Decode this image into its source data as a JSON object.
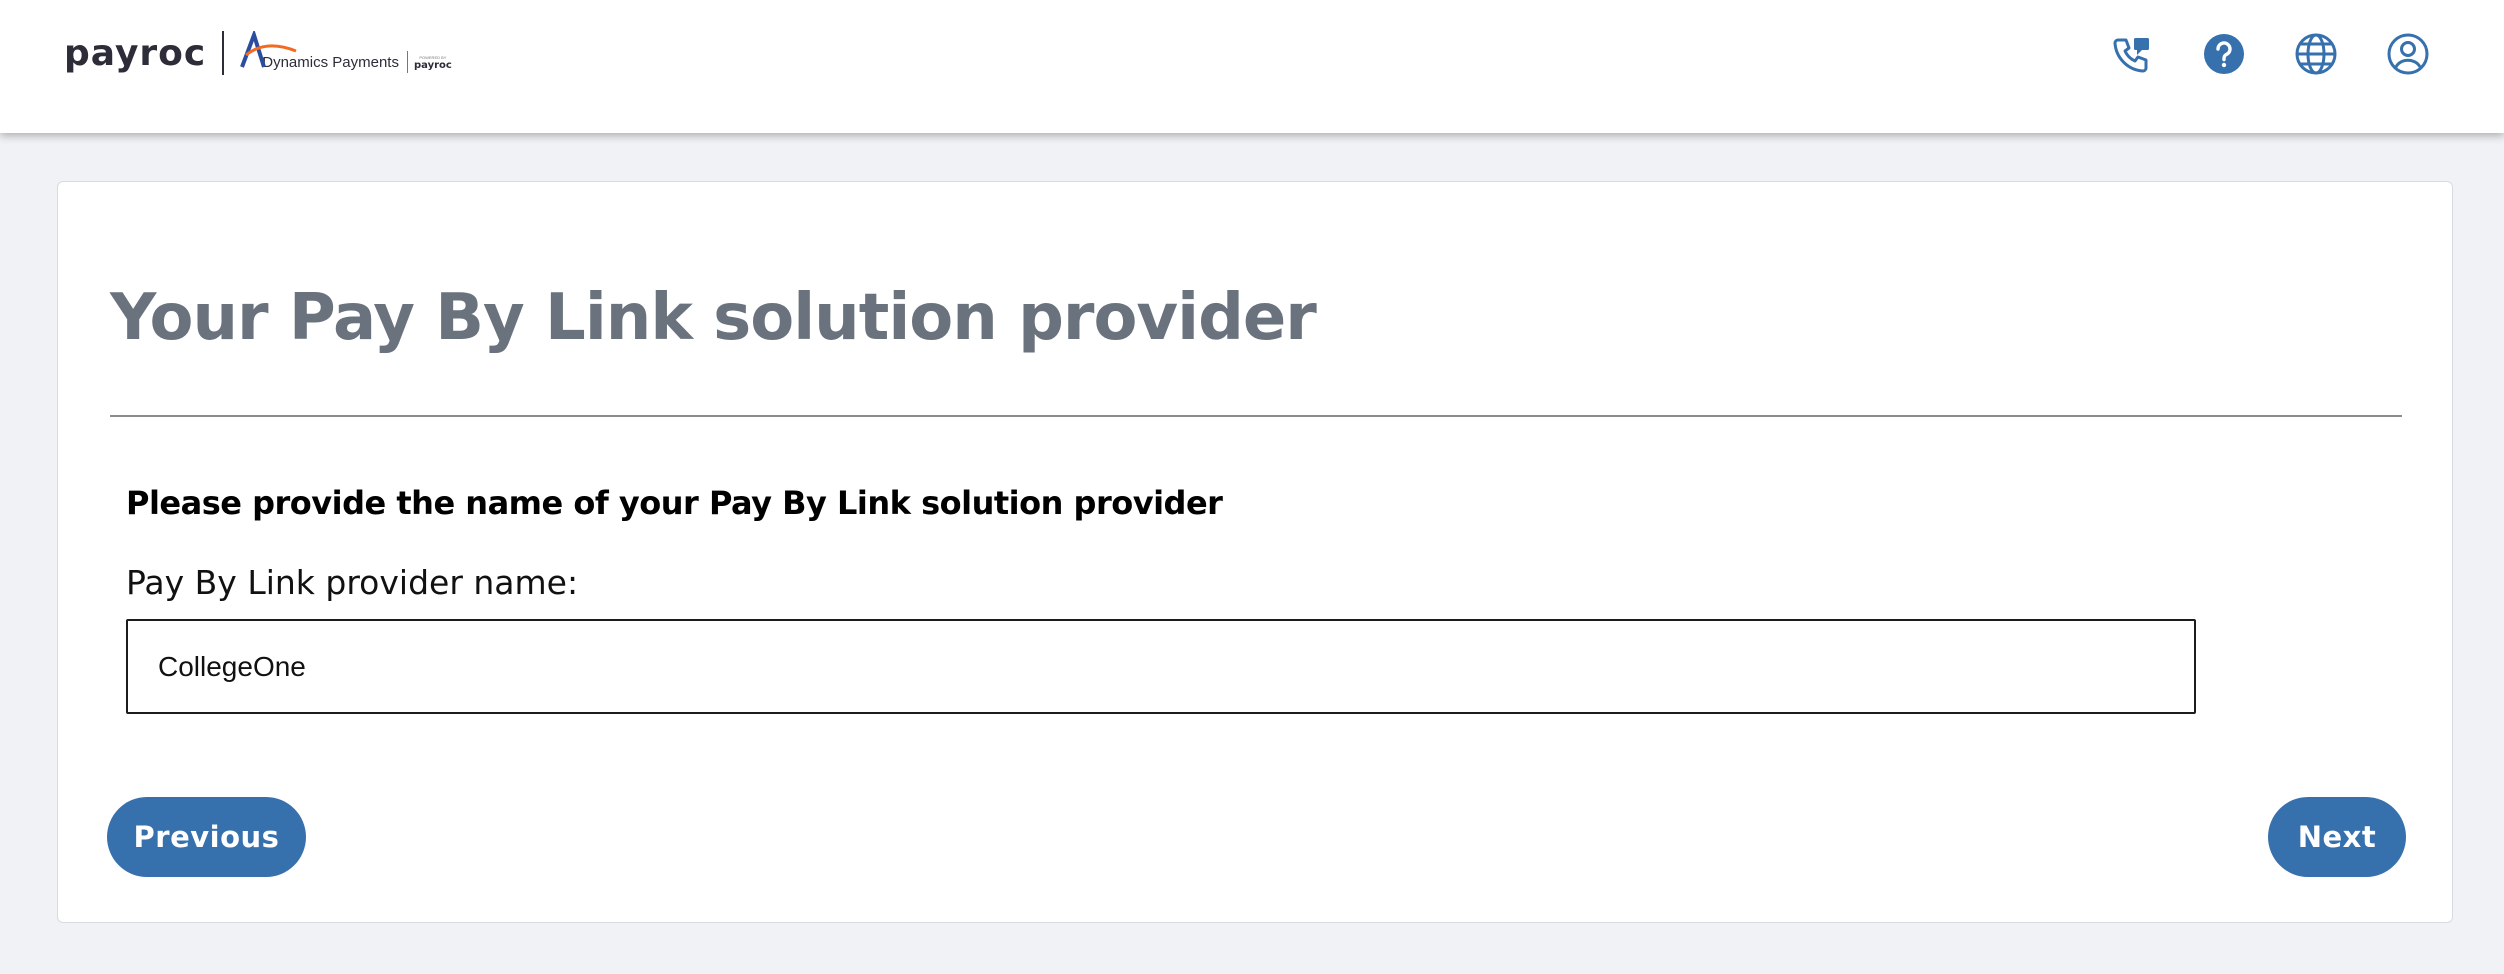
{
  "header": {
    "logo_text": "payroc",
    "logo_partner_text": "Dynamics Payments",
    "logo_partner_sub_top": "POWERED BY",
    "logo_partner_sub": "payroc",
    "icons": [
      "phone-chat-icon",
      "help-icon",
      "globe-icon",
      "account-icon"
    ]
  },
  "page": {
    "title": "Your Pay By Link solution provider",
    "question": "Please provide the name of your Pay By Link solution provider",
    "field": {
      "label": "Pay By Link provider name:",
      "value": "CollegeOne"
    },
    "buttons": {
      "previous": "Previous",
      "next": "Next"
    }
  },
  "colors": {
    "primary": "#3670ad",
    "title": "#6a737d",
    "background": "#f0f2f5",
    "logo_orange": "#f26b21",
    "logo_blue": "#2b4da0"
  }
}
